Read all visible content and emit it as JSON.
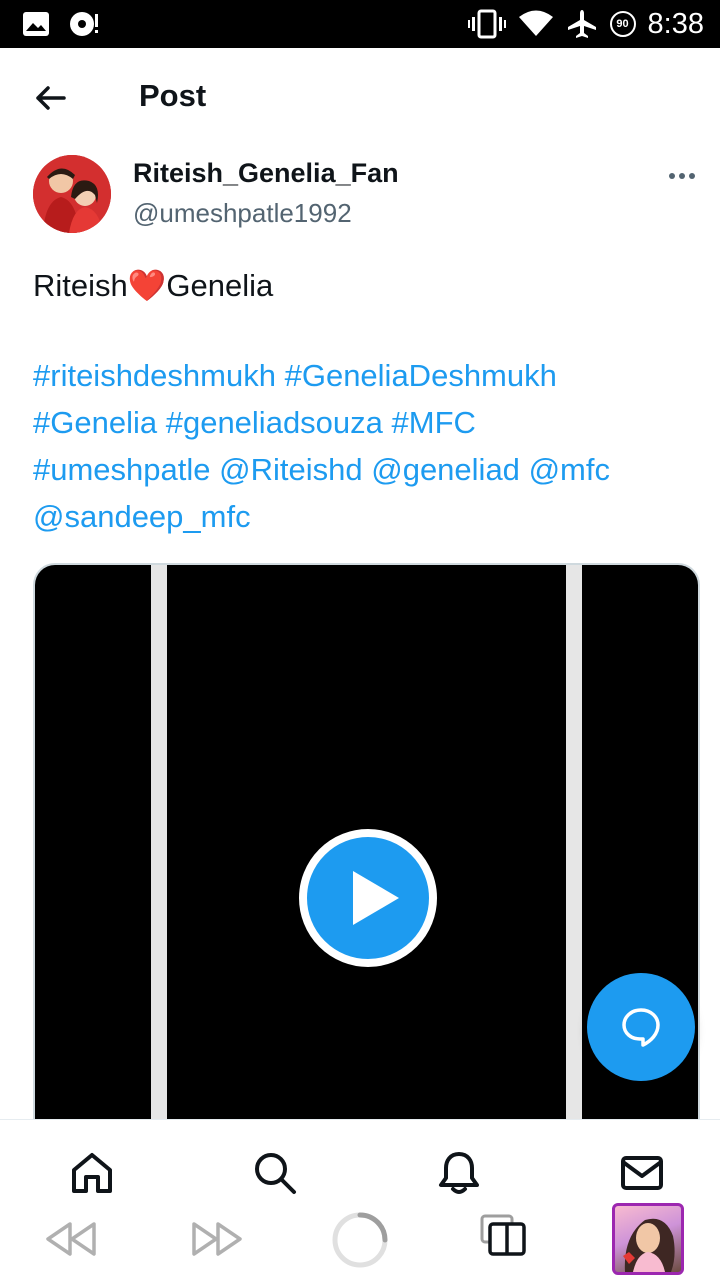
{
  "status_bar": {
    "time": "8:38",
    "battery_badge": "90",
    "icons": [
      "image-icon",
      "media-icon",
      "vibrate-icon",
      "wifi-icon",
      "airplane-icon",
      "battery-saver-icon"
    ]
  },
  "header": {
    "title": "Post",
    "back_icon": "arrow-left-icon"
  },
  "post": {
    "author": {
      "display_name": "Riteish_Genelia_Fan",
      "handle": "@umeshpatle1992"
    },
    "text_before": "Riteish",
    "text_heart": "❤️",
    "text_after": "Genelia",
    "tags": [
      "#riteishdeshmukh",
      "#GeneliaDeshmukh",
      "#Genelia",
      "#geneliadsouza",
      "#MFC",
      "#umeshpatle",
      "@Riteishd",
      "@geneliad",
      "@mfc",
      "@sandeep_mfc"
    ],
    "media": {
      "type": "video",
      "play_icon": "play-icon"
    }
  },
  "colors": {
    "accent": "#1d9bf0",
    "text_primary": "#0f1419",
    "text_secondary": "#536471",
    "heart": "#e0245e"
  },
  "fab": {
    "icon": "reply-bubble-icon"
  },
  "bottom_nav": [
    "home-icon",
    "search-icon",
    "notifications-icon",
    "messages-icon"
  ],
  "browser_toolbar": [
    "rewind-icon",
    "fast-forward-icon",
    "loading-icon",
    "tabs-icon",
    "profile-thumbnail"
  ]
}
